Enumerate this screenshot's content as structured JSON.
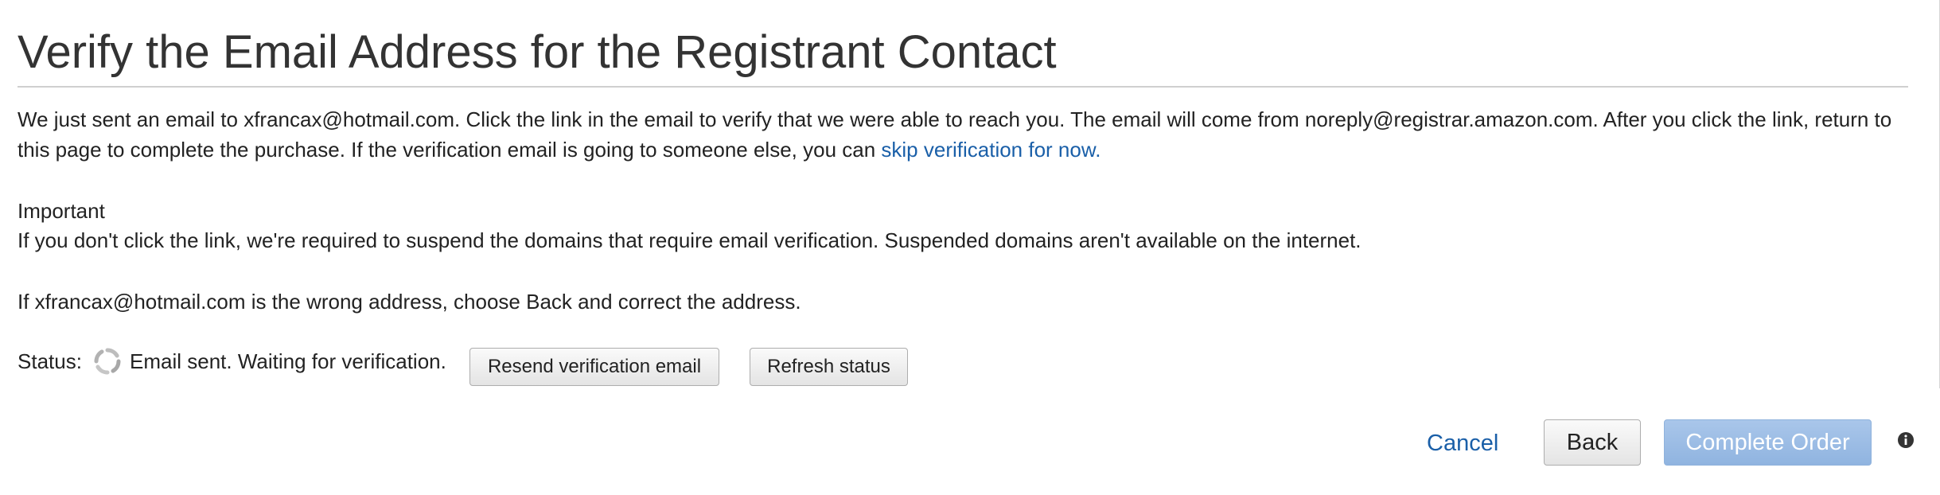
{
  "page": {
    "title": "Verify the Email Address for the Registrant Contact"
  },
  "intro": {
    "text": "We just sent an email to xfrancax@hotmail.com. Click the link in the email to verify that we were able to reach you. The email will come from noreply@registrar.amazon.com. After you click the link, return to this page to complete the purchase. If the verification email is going to someone else, you can ",
    "skip_link": "skip verification for now."
  },
  "important": {
    "heading": "Important",
    "text": "If you don't click the link, we're required to suspend the domains that require email verification. Suspended domains aren't available on the internet."
  },
  "wrong_address": {
    "text_before": "If xfrancax@hotmail.com is the wrong address, choose ",
    "emphasis": "Back",
    "text_after": " and correct the address."
  },
  "status": {
    "label": "Status:",
    "text": "Email sent. Waiting for verification.",
    "icon": "spinner-icon"
  },
  "buttons": {
    "resend": "Resend verification email",
    "refresh": "Refresh status"
  },
  "footer": {
    "cancel": "Cancel",
    "back": "Back",
    "complete": "Complete Order",
    "info_icon": "info-icon"
  },
  "colors": {
    "link": "#1a5fa8",
    "primary_disabled": "#9dbde6",
    "title": "#333333"
  }
}
